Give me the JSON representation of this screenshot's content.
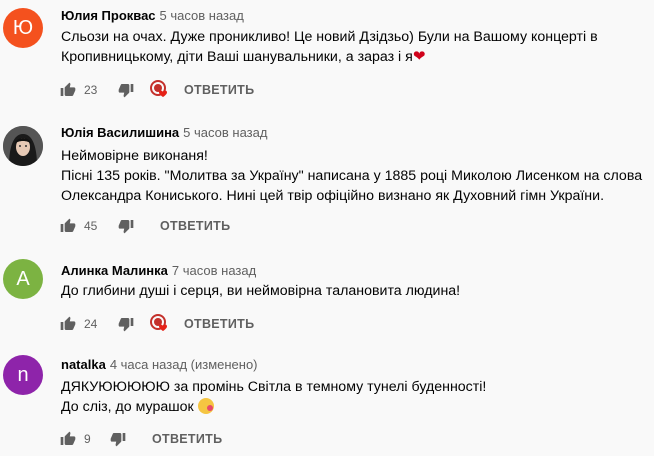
{
  "reply_label": "ОТВЕТИТЬ",
  "comments": [
    {
      "author": "Юлия Проквас",
      "time": "5 часов назад",
      "avatar_letter": "Ю",
      "avatar_color": "#f4511e",
      "lines": [
        "Сльози на очах. Дуже проникливо! Це новий Дзідзьо) Були на Вашому концерті в",
        "Кропивницькому, діти Ваші шанувальники, а зараз і я"
      ],
      "likes": "23",
      "hearted": true
    },
    {
      "author": "Юлія Василишина",
      "time": "5 часов назад",
      "avatar_letter": "",
      "avatar_color": "#2b2b2b",
      "lines": [
        "Неймовірне виконаня!",
        "Пісні 135 років. \"Молитва за Україну\" написана у 1885 році Миколою Лисенком на слова",
        "Олександра Кониського. Нині цей твір офіційно визнано як Духовний гімн України."
      ],
      "likes": "45",
      "hearted": false
    },
    {
      "author": "Алинка Малинка",
      "time": "7 часов назад",
      "avatar_letter": "А",
      "avatar_color": "#7cb342",
      "lines": [
        "До глибини душі і серця, ви неймовірна талановита людина!"
      ],
      "likes": "24",
      "hearted": true
    },
    {
      "author": "natalka",
      "time": "4 часа назад (изменено)",
      "avatar_letter": "n",
      "avatar_color": "#8e24aa",
      "lines": [
        "ДЯКУЮЮЮЮЮ за промінь Світла в темному тунелі буденності!",
        "До сліз, до мурашок"
      ],
      "likes": "9",
      "hearted": false
    }
  ]
}
